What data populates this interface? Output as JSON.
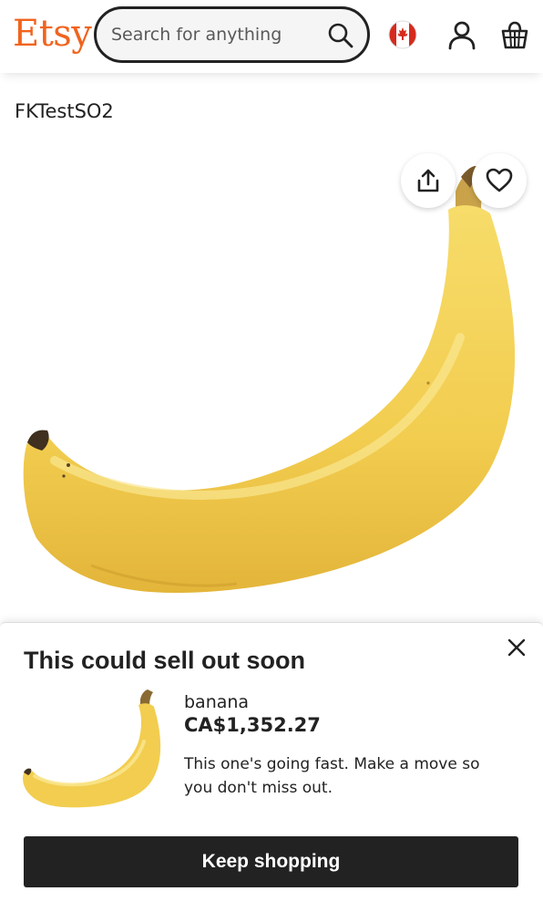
{
  "header": {
    "logo": "Etsy",
    "search_placeholder": "Search for anything",
    "icons": [
      "search-icon",
      "canada-flag-icon",
      "account-icon",
      "cart-icon"
    ]
  },
  "shop": {
    "name": "FKTestSO2"
  },
  "product": {
    "image": "banana",
    "actions": [
      "share-icon",
      "favorite-heart-icon"
    ]
  },
  "popup": {
    "title": "This could sell out soon",
    "item_name": "banana",
    "price": "CA$1,352.27",
    "message": "This one's going fast. Make a move so you don't miss out.",
    "button_label": "Keep shopping"
  },
  "colors": {
    "brand": "#f1641e",
    "button_bg": "#222222",
    "flag_red": "#d52b1e",
    "banana_yellow": "#f3d25a"
  }
}
